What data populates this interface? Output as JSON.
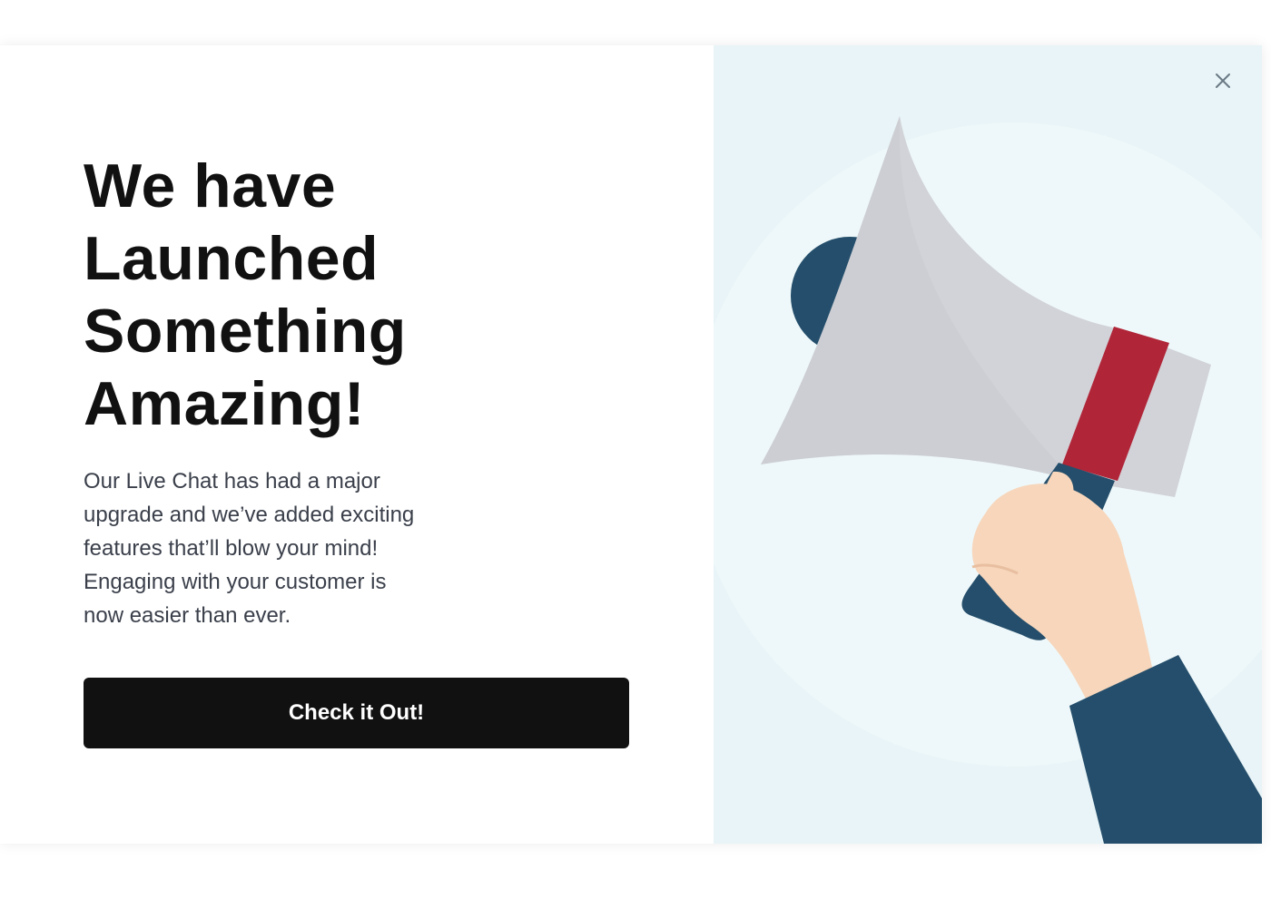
{
  "modal": {
    "headline_lines": [
      "We have",
      "Launched",
      "Something",
      "Amazing!"
    ],
    "body_lines": [
      "Our Live Chat has had a major",
      "upgrade and we’ve added exciting",
      "features that’ll blow your mind!",
      "Engaging with your customer is",
      "now easier than ever."
    ],
    "cta_label": "Check it Out!",
    "close_icon": "close-icon",
    "illustration_icon": "megaphone-icon"
  },
  "colors": {
    "text_primary": "#111111",
    "body_text": "#3a3f4a",
    "button_bg": "#111111",
    "button_text": "#ffffff",
    "panel_bg": "#e8f4f7",
    "megaphone_body": "#d2d3d8",
    "megaphone_stripe": "#b02538",
    "navy": "#244e6b",
    "skin": "#f7d6bb"
  }
}
